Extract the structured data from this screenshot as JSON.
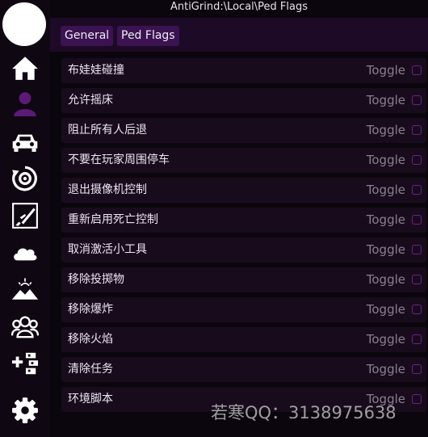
{
  "window": {
    "title": "AntiGrind:\\Local\\Ped Flags"
  },
  "tabs": [
    {
      "label": "General"
    },
    {
      "label": "Ped Flags"
    }
  ],
  "sidebar": {
    "items": [
      {
        "icon": "home-icon"
      },
      {
        "icon": "person-icon",
        "active": true
      },
      {
        "icon": "car-icon"
      },
      {
        "icon": "refresh-target-icon"
      },
      {
        "icon": "rifle-icon"
      },
      {
        "icon": "cloud-icon"
      },
      {
        "icon": "landscape-icon"
      },
      {
        "icon": "people-icon"
      },
      {
        "icon": "add-list-icon"
      },
      {
        "icon": "gear-icon"
      }
    ]
  },
  "rows": [
    {
      "label": "布娃娃碰撞",
      "toggle": "Toggle"
    },
    {
      "label": "允许摇床",
      "toggle": "Toggle"
    },
    {
      "label": "阻止所有人后退",
      "toggle": "Toggle"
    },
    {
      "label": "不要在玩家周围停车",
      "toggle": "Toggle"
    },
    {
      "label": "退出摄像机控制",
      "toggle": "Toggle"
    },
    {
      "label": "重新启用死亡控制",
      "toggle": "Toggle"
    },
    {
      "label": "取消激活小工具",
      "toggle": "Toggle"
    },
    {
      "label": "移除投掷物",
      "toggle": "Toggle"
    },
    {
      "label": "移除爆炸",
      "toggle": "Toggle"
    },
    {
      "label": "移除火焰",
      "toggle": "Toggle"
    },
    {
      "label": "清除任务",
      "toggle": "Toggle"
    },
    {
      "label": "环境脚本",
      "toggle": "Toggle"
    }
  ],
  "watermark": "若寒QQ：3138975638",
  "colors": {
    "accent": "#6d1f8c",
    "tab_bg": "#3a1350",
    "row_bg": "#180c1c",
    "active_icon": "#5b1a78"
  }
}
